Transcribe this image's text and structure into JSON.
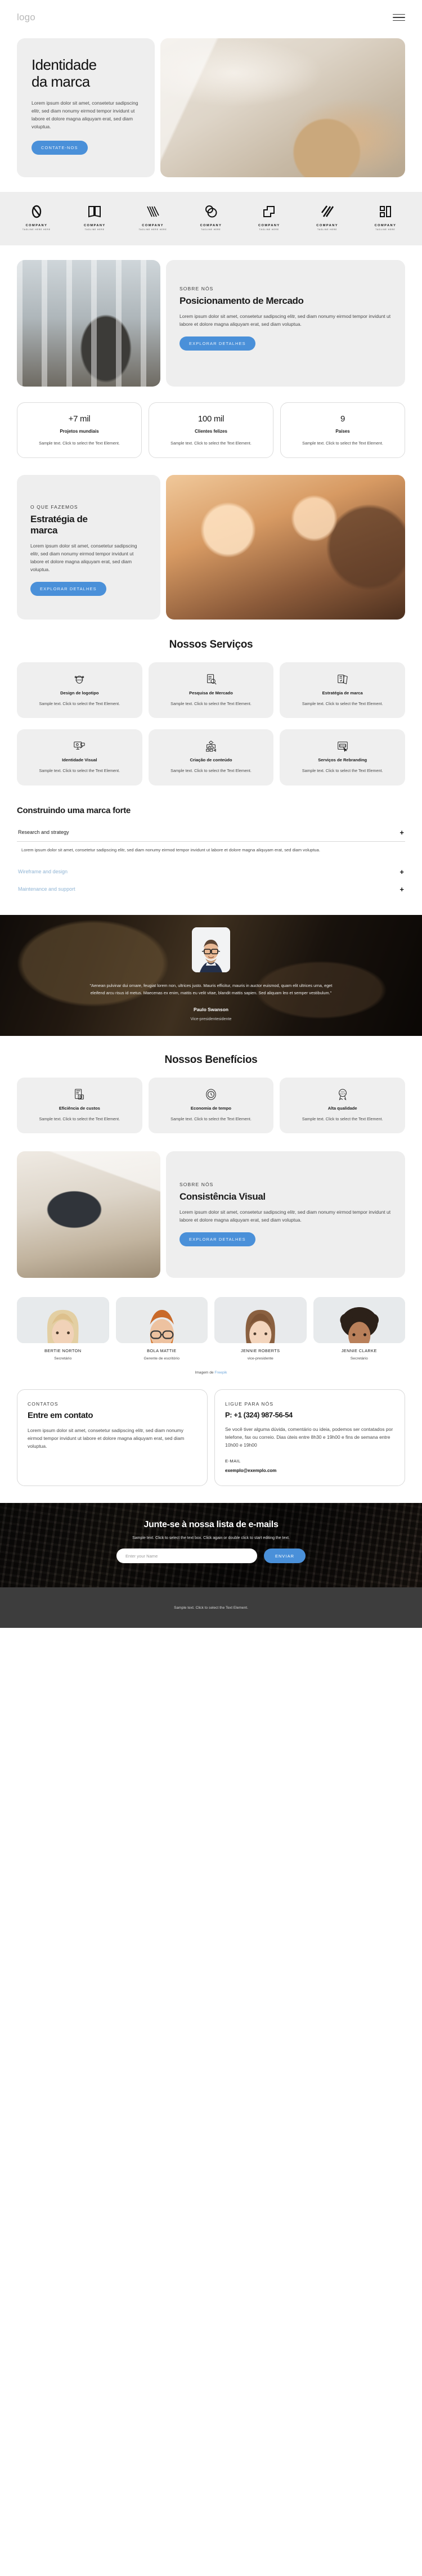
{
  "header": {
    "logo": "logo",
    "menu_icon": "hamburger-menu"
  },
  "hero": {
    "title_line1": "Identidade",
    "title_line2": "da marca",
    "paragraph": "Lorem ipsum dolor sit amet, consetetur sadipscing elitr, sed diam nonumy eirmod tempor invidunt ut labore et dolore magna aliquyam erat, sed diam voluptua.",
    "cta": "CONTATE-NOS",
    "image_alt": "desk-workspace-photo"
  },
  "clients": {
    "items": [
      {
        "name": "COMPANY",
        "tagline": "TAGLINE HERE HERE",
        "mark": "ring-swirl"
      },
      {
        "name": "COMPANY",
        "tagline": "TAGLINE HERE",
        "mark": "open-book"
      },
      {
        "name": "COMPANY",
        "tagline": "TAGLINE HERE HERE",
        "mark": "chevron-lines"
      },
      {
        "name": "COMPANY",
        "tagline": "TAGLINE HERE",
        "mark": "double-circle"
      },
      {
        "name": "COMPANY",
        "tagline": "TAGLINE HERE",
        "mark": "corner-squares"
      },
      {
        "name": "COMPANY",
        "tagline": "TAGLINE HERE",
        "mark": "slash-bolt"
      },
      {
        "name": "COMPANY",
        "tagline": "TAGLINE HERE",
        "mark": "block-letters"
      }
    ]
  },
  "about": {
    "kicker": "SOBRE NÓS",
    "title": "Posicionamento de Mercado",
    "paragraph": "Lorem ipsum dolor sit amet, consetetur sadipscing elitr, sed diam nonumy eirmod tempor invidunt ut labore et dolore magna aliquyam erat, sed diam voluptua.",
    "cta": "EXPLORAR DETALHES",
    "image_alt": "office-window-photo"
  },
  "stats": {
    "items": [
      {
        "number": "+7 mil",
        "label": "Projetos mundiais",
        "desc": "Sample text. Click to select the Text Element."
      },
      {
        "number": "100 mil",
        "label": "Clientes felizes",
        "desc": "Sample text. Click to select the Text Element."
      },
      {
        "number": "9",
        "label": "Países",
        "desc": "Sample text. Click to select the Text Element."
      }
    ]
  },
  "strategy": {
    "kicker": "O QUE FAZEMOS",
    "title_line1": "Estratégia de",
    "title_line2": "marca",
    "paragraph": "Lorem ipsum dolor sit amet, consetetur sadipscing elitr, sed diam nonumy eirmod tempor invidunt ut labore et dolore magna aliquyam erat, sed diam voluptua.",
    "cta": "EXPLORAR DETALHES",
    "image_alt": "people-celebrating-photo"
  },
  "services": {
    "title": "Nossos Serviços",
    "items": [
      {
        "icon": "logo-design-icon",
        "title": "Design de logotipo",
        "desc": "Sample text. Click to select the Text Element."
      },
      {
        "icon": "market-research-icon",
        "title": "Pesquisa de Mercado",
        "desc": "Sample text. Click to select the Text Element."
      },
      {
        "icon": "brand-strategy-icon",
        "title": "Estratégia de marca",
        "desc": "Sample text. Click to select the Text Element."
      },
      {
        "icon": "visual-identity-icon",
        "title": "Identidade Visual",
        "desc": "Sample text. Click to select the Text Element."
      },
      {
        "icon": "content-creation-icon",
        "title": "Criação de conteúdo",
        "desc": "Sample text. Click to select the Text Element."
      },
      {
        "icon": "rebranding-icon",
        "title": "Serviços de Rebranding",
        "desc": "Sample text. Click to select the Text Element."
      }
    ]
  },
  "accordion": {
    "title": "Construindo uma marca forte",
    "items": [
      {
        "label": "Research and strategy",
        "open": true,
        "body": "Lorem ipsum dolor sit amet, consetetur sadipscing elitr, sed diam nonumy eirmod tempor invidunt ut labore et dolore magna aliquyam erat, sed diam voluptua.",
        "toggle": "+"
      },
      {
        "label": "Wireframe and design",
        "open": false,
        "body": "",
        "toggle": "+"
      },
      {
        "label": "Maintenance and support",
        "open": false,
        "body": "",
        "toggle": "+"
      }
    ]
  },
  "testimonial": {
    "quote": "\"Aenean pulvinar dui ornare, feugiat lorem non, ultrices justo. Mauris efficitur, mauris in auctor euismod, quam elit ultrices urna, eget eleifend arcu risus id metus. Maecenas ex enim, mattis eu velit vitae, blandit mattis sapien. Sed aliquam leo et semper vestibulum.\"",
    "name": "Paulo Swanson",
    "role": "Vice-presidentesidente",
    "avatar_alt": "man-with-glasses-portrait",
    "background_alt": "dark-workspace-photo"
  },
  "benefits": {
    "title": "Nossos Benefícios",
    "items": [
      {
        "icon": "cost-efficiency-icon",
        "title": "Eficiência de custos",
        "desc": "Sample text. Click to select the Text Element."
      },
      {
        "icon": "time-saving-icon",
        "title": "Economia de tempo",
        "desc": "Sample text. Click to select the Text Element."
      },
      {
        "icon": "high-quality-icon",
        "title": "Alta qualidade",
        "desc": "Sample text. Click to select the Text Element."
      }
    ]
  },
  "visual_consistency": {
    "kicker": "SOBRE NÓS",
    "title": "Consistência Visual",
    "paragraph": "Lorem ipsum dolor sit amet, consetetur sadipscing elitr, sed diam nonumy eirmod tempor invidunt ut labore et dolore magna aliquyam erat, sed diam voluptua.",
    "cta": "EXPLORAR DETALHES",
    "image_alt": "laptop-top-view-photo"
  },
  "team": {
    "members": [
      {
        "name": "BERTIE NORTON",
        "role": "Secretário",
        "photo_alt": "blonde-woman-portrait"
      },
      {
        "name": "BOLA MATTIE",
        "role": "Gerente de escritório",
        "photo_alt": "bearded-man-portrait"
      },
      {
        "name": "JENNIE ROBERTS",
        "role": "vice-presidente",
        "photo_alt": "brunette-woman-portrait"
      },
      {
        "name": "JENNIE CLARKE",
        "role": "Secretário",
        "photo_alt": "curly-hair-woman-portrait"
      }
    ],
    "credit_prefix": "Imagem de ",
    "credit_link": "Freepik"
  },
  "contact": {
    "left": {
      "kicker": "CONTATOS",
      "title": "Entre em contato",
      "paragraph": "Lorem ipsum dolor sit amet, consetetur sadipscing elitr, sed diam nonumy eirmod tempor invidunt ut labore et dolore magna aliquyam erat, sed diam voluptua."
    },
    "right": {
      "kicker": "LIGUE PARA NÓS",
      "phone": "P: +1 (324) 987-56-54",
      "paragraph": "Se você tiver alguma dúvida, comentário ou ideia, podemos ser contatados por telefone, fax ou correio. Dias úteis entre 8h30 e 19h00 e fins de semana entre 10h00 e 19h00",
      "email_label": "E-MAIL",
      "email": "exemplo@exemplo.com"
    }
  },
  "newsletter": {
    "title": "Junte-se à nossa lista de e-mails",
    "subtitle": "Sample text. Click to select the text box. Click again or double click to start editing the text.",
    "input_placeholder": "Enter your Name",
    "input_value": "",
    "button": "ENVIAR",
    "background_alt": "keyboard-hands-photo"
  },
  "footer": {
    "text": "Sample text. Click to select the Text Element."
  },
  "colors": {
    "accent": "#4a90d9",
    "surface": "#eeeeee",
    "footer": "#3d3d3d",
    "link": "#6fa8dc"
  }
}
